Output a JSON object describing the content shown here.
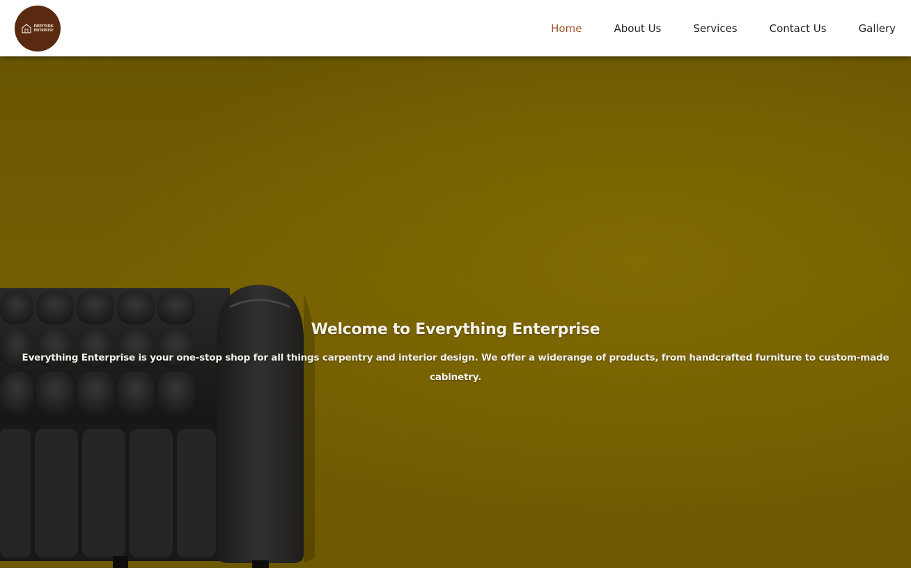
{
  "brand": {
    "logo_line1": "EVERYTHING",
    "logo_line2": "ENTERPRISE",
    "logo_color": "#5a2a10"
  },
  "nav": {
    "items": [
      {
        "label": "Home",
        "active": true
      },
      {
        "label": "About Us",
        "active": false
      },
      {
        "label": "Services",
        "active": false
      },
      {
        "label": "Contact Us",
        "active": false
      },
      {
        "label": "Gallery",
        "active": false
      }
    ],
    "active_color": "#a0522d"
  },
  "hero": {
    "title": "Welcome to Everything Enterprise",
    "description": "Everything Enterprise is your one-stop shop for all things carpentry and interior design. We offer a widerange of products, from handcrafted furniture to custom-made cabinetry.",
    "background_color": "#7a6503",
    "image_subject": "black-leather-sofa"
  }
}
